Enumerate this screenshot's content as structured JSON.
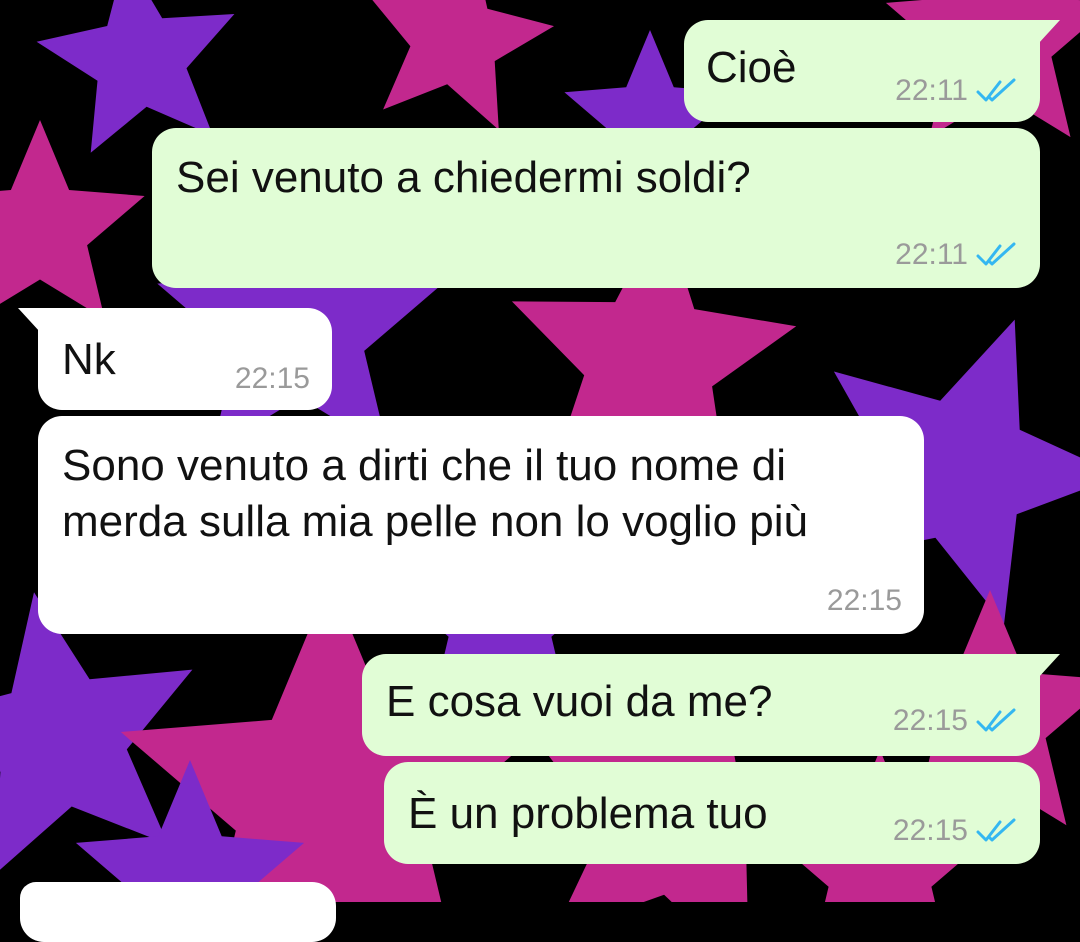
{
  "theme": {
    "outgoing_bubble": "#e1fdd6",
    "incoming_bubble": "#ffffff",
    "read_tick_color": "#34b7f1",
    "time_color": "#9a9a9a",
    "wallpaper_colors": [
      "#000000",
      "#7d2bc9",
      "#c2288e"
    ]
  },
  "wallpaper": {
    "pattern": "stars"
  },
  "messages": [
    {
      "direction": "outgoing",
      "text": "Cioè",
      "time": "22:11",
      "status": "read",
      "status_icon": "double-check-icon"
    },
    {
      "direction": "outgoing",
      "text": "Sei venuto a chiedermi soldi?",
      "time": "22:11",
      "status": "read",
      "status_icon": "double-check-icon"
    },
    {
      "direction": "incoming",
      "text": "Nk",
      "time": "22:15"
    },
    {
      "direction": "incoming",
      "text": "Sono venuto a dirti che il tuo nome di\nmerda sulla mia pelle non lo voglio più",
      "time": "22:15"
    },
    {
      "direction": "outgoing",
      "text": "E cosa vuoi da me?",
      "time": "22:15",
      "status": "read",
      "status_icon": "double-check-icon"
    },
    {
      "direction": "outgoing",
      "text": "È un problema tuo",
      "time": "22:15",
      "status": "read",
      "status_icon": "double-check-icon"
    }
  ]
}
